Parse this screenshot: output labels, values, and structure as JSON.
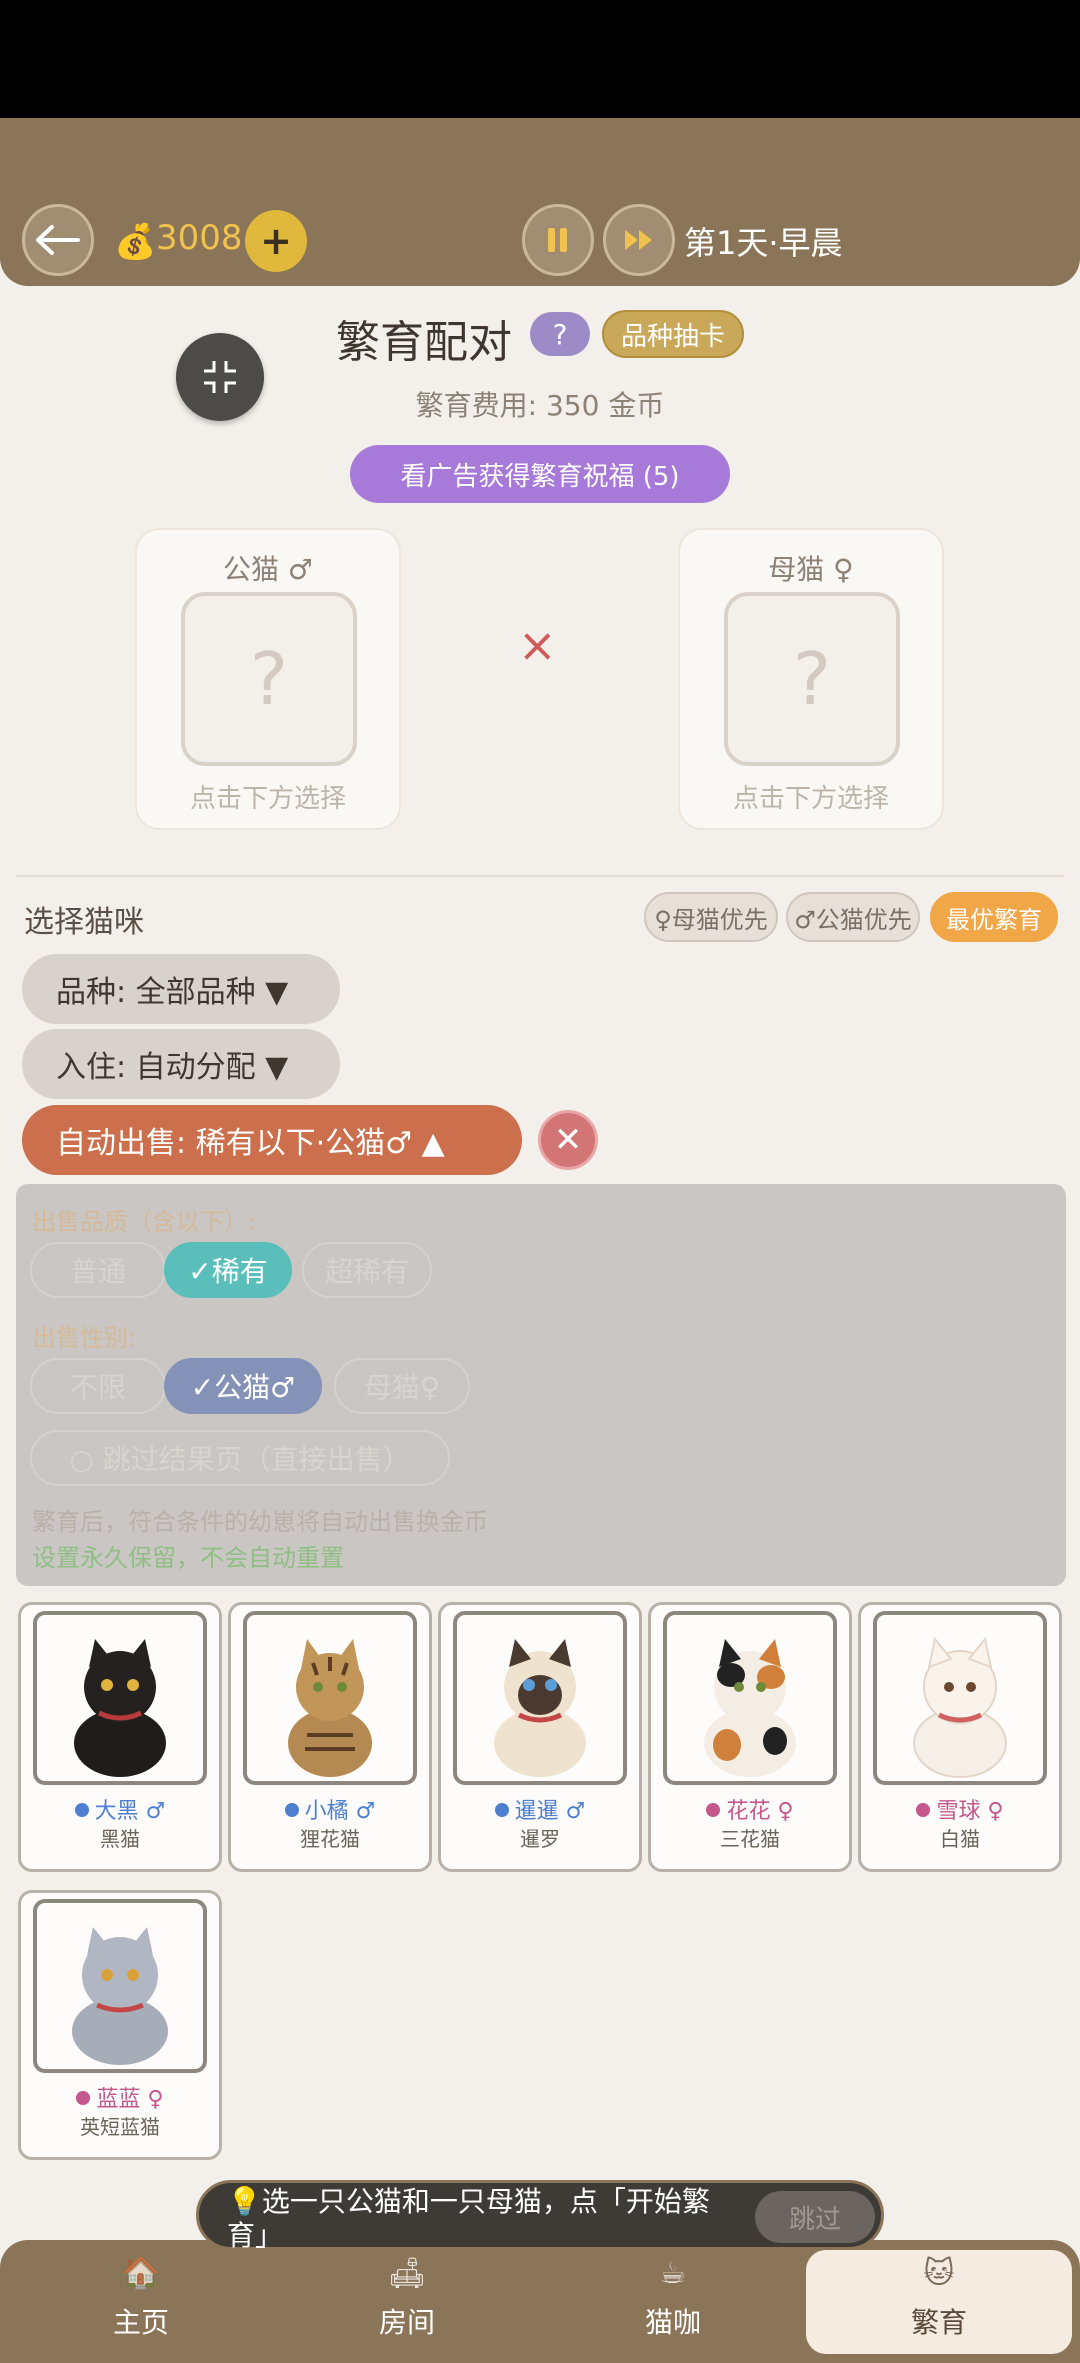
{
  "header": {
    "coins": "3008",
    "coin_icon": "money-bag-icon",
    "day_label": "第1天·早晨"
  },
  "breeding": {
    "title": "繁育配对",
    "help_label": "?",
    "draw_label": "品种抽卡",
    "cost": "繁育费用: 350 金币",
    "ad_button": "看广告获得繁育祝福 (5)",
    "male_slot_label": "公猫 ♂",
    "female_slot_label": "母猫 ♀",
    "slot_placeholder": "?",
    "slot_hint": "点击下方选择",
    "times": "×"
  },
  "select": {
    "title": "选择猫咪",
    "chips": [
      "♀母猫优先",
      "♂公猫优先",
      "最优繁育"
    ],
    "breed_filter": "品种: 全部品种 ▼",
    "room_filter": "入住: 自动分配 ▼",
    "auto_sell": "自动出售: 稀有以下·公猫♂ ▲",
    "close": "✕"
  },
  "panel": {
    "quality_label": "出售品质（含以下）:",
    "quality_options": [
      "普通",
      "✓稀有",
      "超稀有"
    ],
    "gender_label": "出售性别:",
    "gender_options": [
      "不限",
      "✓公猫♂",
      "母猫♀"
    ],
    "skip_result": "○ 跳过结果页（直接出售）",
    "note": "繁育后，符合条件的幼崽将自动出售换金币",
    "note_green": "设置永久保留，不会自动重置"
  },
  "cats": [
    {
      "name": "大黑 ♂",
      "breed": "黑猫",
      "gender": "male"
    },
    {
      "name": "小橘 ♂",
      "breed": "狸花猫",
      "gender": "male"
    },
    {
      "name": "暹暹 ♂",
      "breed": "暹罗",
      "gender": "male"
    },
    {
      "name": "花花 ♀",
      "breed": "三花猫",
      "gender": "female"
    },
    {
      "name": "雪球 ♀",
      "breed": "白猫",
      "gender": "female"
    },
    {
      "name": "蓝蓝 ♀",
      "breed": "英短蓝猫",
      "gender": "female"
    }
  ],
  "tip": {
    "text": "💡选一只公猫和一只母猫，点「开始繁育」",
    "skip": "跳过"
  },
  "nav": [
    {
      "label": "主页",
      "icon": "home-icon"
    },
    {
      "label": "房间",
      "icon": "room-icon"
    },
    {
      "label": "猫咖",
      "icon": "cafe-icon"
    },
    {
      "label": "繁育",
      "icon": "breed-icon"
    }
  ],
  "colors": {
    "topbar": "#8b7558",
    "accent_orange": "#cc6f4c",
    "ad_purple": "#a77ad9",
    "best_breed": "#f1a648",
    "male": "#4f7fd0",
    "female": "#c4588c"
  }
}
